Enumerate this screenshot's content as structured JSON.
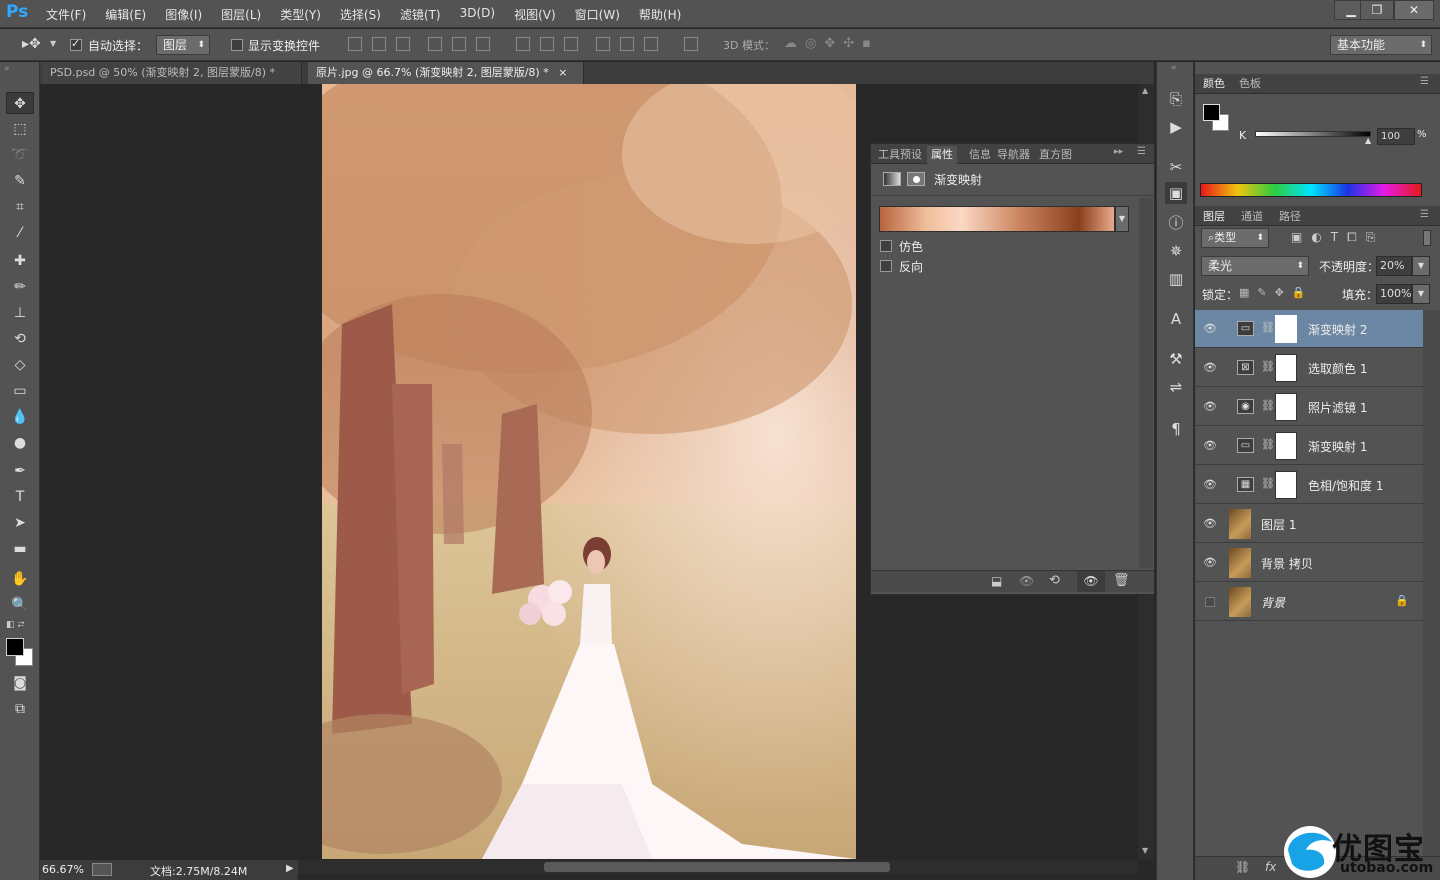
{
  "app": {
    "logo": "Ps"
  },
  "menu": [
    "文件(F)",
    "编辑(E)",
    "图像(I)",
    "图层(L)",
    "类型(Y)",
    "选择(S)",
    "滤镜(T)",
    "3D(D)",
    "视图(V)",
    "窗口(W)",
    "帮助(H)"
  ],
  "window_controls": {
    "minimize": "▁",
    "restore": "❐",
    "close": "✕"
  },
  "options": {
    "auto_select_label": "自动选择：",
    "auto_select_target": "图层",
    "show_transform_label": "显示变换控件",
    "mode_3d_label": "3D 模式：",
    "workspace": "基本功能"
  },
  "tabs": [
    {
      "label": "PSD.psd @ 50% (渐变映射 2, 图层蒙版/8) *",
      "close": "×"
    },
    {
      "label": "原片.jpg @ 66.7% (渐变映射 2, 图层蒙版/8) *",
      "close": "×"
    }
  ],
  "status": {
    "zoom": "66.67%",
    "doc": "文档:2.75M/8.24M"
  },
  "properties": {
    "tabs": [
      "工具预设",
      "属性",
      "信息",
      "导航器",
      "直方图"
    ],
    "active_tab": "属性",
    "title": "渐变映射",
    "dither_label": "仿色",
    "reverse_label": "反向",
    "gradient_colors": [
      "#b8633f",
      "#f0bf9d",
      "#fbd8c4",
      "#c9845e",
      "#8a3f1c",
      "#e7a98a"
    ]
  },
  "color_panel": {
    "tabs": [
      "颜色",
      "色板"
    ],
    "channel_label": "K",
    "channel_value": "100",
    "percent": "%"
  },
  "layers_panel": {
    "tabs": [
      "图层",
      "通道",
      "路径"
    ],
    "filter_label": "类型",
    "blend_mode": "柔光",
    "opacity_label": "不透明度：",
    "opacity_value": "20%",
    "lock_label": "锁定：",
    "fill_label": "填充：",
    "fill_value": "100%",
    "layers": [
      {
        "name": "渐变映射 2",
        "kind": "adjustment",
        "icon": "▭",
        "selected": true,
        "visible": true
      },
      {
        "name": "选取颜色 1",
        "kind": "adjustment",
        "icon": "⊠",
        "selected": false,
        "visible": true
      },
      {
        "name": "照片滤镜 1",
        "kind": "adjustment",
        "icon": "◉",
        "selected": false,
        "visible": true
      },
      {
        "name": "渐变映射 1",
        "kind": "adjustment",
        "icon": "▭",
        "selected": false,
        "visible": true
      },
      {
        "name": "色相/饱和度 1",
        "kind": "adjustment",
        "icon": "▦",
        "selected": false,
        "visible": true
      },
      {
        "name": "图层 1",
        "kind": "pixel",
        "selected": false,
        "visible": true
      },
      {
        "name": "背景 拷贝",
        "kind": "pixel",
        "selected": false,
        "visible": true
      },
      {
        "name": "背景",
        "kind": "background",
        "selected": false,
        "visible": false,
        "locked": true
      }
    ]
  },
  "watermark": {
    "text": "优图宝",
    "url": "utobao.com"
  }
}
